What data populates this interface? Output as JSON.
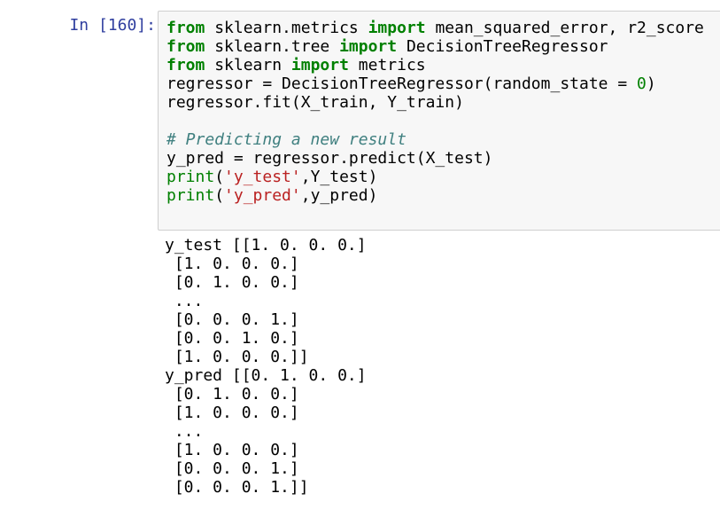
{
  "cell": {
    "prompt": "In [160]:",
    "code": {
      "line1": {
        "kw1": "from",
        "mod": " sklearn.metrics ",
        "kw2": "import",
        "rest": " mean_squared_error, r2_score"
      },
      "line2": {
        "kw1": "from",
        "mod": " sklearn.tree ",
        "kw2": "import",
        "rest": " DecisionTreeRegressor"
      },
      "line3": {
        "kw1": "from",
        "mod": " sklearn ",
        "kw2": "import",
        "rest": " metrics"
      },
      "line4": {
        "pre": "regressor = DecisionTreeRegressor(random_state = ",
        "num": "0",
        "post": ")"
      },
      "line5": "regressor.fit(X_train, Y_train)",
      "line7": "# Predicting a new result",
      "line8": "y_pred = regressor.predict(X_test)",
      "line9": {
        "fn": "print",
        "open": "(",
        "str": "'y_test'",
        "rest": ",Y_test)"
      },
      "line10": {
        "fn": "print",
        "open": "(",
        "str": "'y_pred'",
        "rest": ",y_pred)"
      }
    },
    "output": {
      "lines": [
        "y_test [[1. 0. 0. 0.]",
        " [1. 0. 0. 0.]",
        " [0. 1. 0. 0.]",
        " ...",
        " [0. 0. 0. 1.]",
        " [0. 0. 1. 0.]",
        " [1. 0. 0. 0.]]",
        "y_pred [[0. 1. 0. 0.]",
        " [0. 1. 0. 0.]",
        " [1. 0. 0. 0.]",
        " ...",
        " [1. 0. 0. 0.]",
        " [0. 0. 0. 1.]",
        " [0. 0. 0. 1.]]"
      ]
    }
  }
}
